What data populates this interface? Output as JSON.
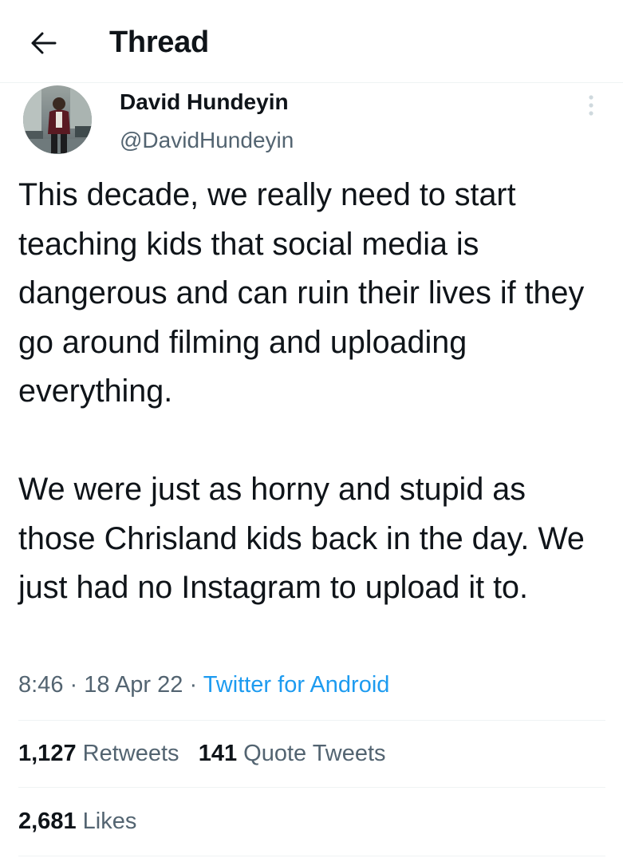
{
  "header": {
    "back_icon": "arrow-left-icon",
    "title": "Thread"
  },
  "tweet": {
    "author": {
      "display_name": "David Hundeyin",
      "handle": "@DavidHundeyin",
      "avatar_icon": "profile-photo",
      "more_icon": "more-vertical-icon"
    },
    "paragraphs": [
      "This decade, we really need to start teaching kids that social media is dangerous and can ruin their lives if they go around filming and uploading everything.",
      "We were just as horny and stupid as those Chrisland kids back in the day. We just had no Instagram to upload it to."
    ],
    "time": "8:46",
    "separator": "·",
    "date": "18 Apr 22",
    "source": "Twitter for Android"
  },
  "stats": {
    "retweets_count": "1,127",
    "retweets_label": "Retweets",
    "quote_tweets_count": "141",
    "quote_tweets_label": "Quote Tweets",
    "likes_count": "2,681",
    "likes_label": "Likes"
  },
  "colors": {
    "text_primary": "#0f1419",
    "text_secondary": "#536471",
    "accent": "#1d9bf0",
    "divider": "#eff3f4"
  }
}
